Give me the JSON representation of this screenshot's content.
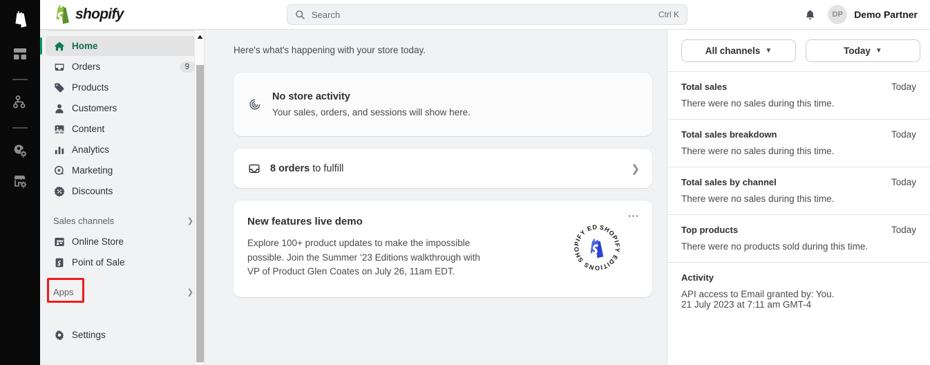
{
  "rail": {
    "items": [
      {
        "name": "shopify-logo-icon",
        "label": "Shopify"
      },
      {
        "name": "dashboard-icon",
        "label": "Dashboard"
      },
      {
        "name": "network-icon",
        "label": "Network"
      },
      {
        "name": "account-settings-icon",
        "label": "Account settings"
      },
      {
        "name": "store-settings-icon",
        "label": "Store settings"
      }
    ]
  },
  "topbar": {
    "brand": "shopify",
    "search": {
      "placeholder": "Search",
      "shortcut": "Ctrl K"
    },
    "user": {
      "initials": "DP",
      "name": "Demo Partner"
    }
  },
  "sidebar": {
    "items": [
      {
        "label": "Home",
        "icon": "home-icon",
        "active": true,
        "badge": ""
      },
      {
        "label": "Orders",
        "icon": "orders-inbox-icon",
        "active": false,
        "badge": "9"
      },
      {
        "label": "Products",
        "icon": "products-tag-icon",
        "active": false,
        "badge": ""
      },
      {
        "label": "Customers",
        "icon": "customers-person-icon",
        "active": false,
        "badge": ""
      },
      {
        "label": "Content",
        "icon": "content-image-icon",
        "active": false,
        "badge": ""
      },
      {
        "label": "Analytics",
        "icon": "analytics-bar-chart-icon",
        "active": false,
        "badge": ""
      },
      {
        "label": "Marketing",
        "icon": "marketing-target-icon",
        "active": false,
        "badge": ""
      },
      {
        "label": "Discounts",
        "icon": "discounts-badge-icon",
        "active": false,
        "badge": ""
      }
    ],
    "sales_channels_header": "Sales channels",
    "channels": [
      {
        "label": "Online Store",
        "icon": "online-store-icon"
      },
      {
        "label": "Point of Sale",
        "icon": "point-of-sale-icon"
      }
    ],
    "apps_header": "Apps",
    "settings": {
      "label": "Settings",
      "icon": "settings-gear-icon"
    },
    "highlight_color": "#ee1c1c",
    "active_accent_color": "#0e9e6e"
  },
  "main": {
    "subtitle": "Here's what's happening with your store today.",
    "activity_card": {
      "icon": "store-activity-spiral-icon",
      "title": "No store activity",
      "subtitle": "Your sales, orders, and sessions will show here."
    },
    "orders_card": {
      "icon": "orders-inbox-icon",
      "strong": "8 orders",
      "rest": " to fulfill",
      "chevron": "chevron-right-icon"
    },
    "promo_card": {
      "title": "New features live demo",
      "body": "Explore 100+ product updates to make the impossible possible. Join the Summer ‘23 Editions walkthrough with VP of Product Glen Coates on July 26, 11am EDT.",
      "badge_text": "SHOPIFY EDITIONS",
      "menu_icon": "more-options-icon"
    }
  },
  "right_panel": {
    "filters": [
      {
        "label": "All channels",
        "icon": "chevron-down-icon"
      },
      {
        "label": "Today",
        "icon": "chevron-down-icon"
      }
    ],
    "sections": [
      {
        "title": "Total sales",
        "when": "Today",
        "body": "There were no sales during this time.",
        "body2": ""
      },
      {
        "title": "Total sales breakdown",
        "when": "Today",
        "body": "There were no sales during this time.",
        "body2": ""
      },
      {
        "title": "Total sales by channel",
        "when": "Today",
        "body": "There were no sales during this time.",
        "body2": ""
      },
      {
        "title": "Top products",
        "when": "Today",
        "body": "There were no products sold during this time.",
        "body2": ""
      },
      {
        "title": "Activity",
        "when": "",
        "body": "API access to Email granted by: You.",
        "body2": "21 July 2023 at 7:11 am GMT-4"
      }
    ]
  }
}
